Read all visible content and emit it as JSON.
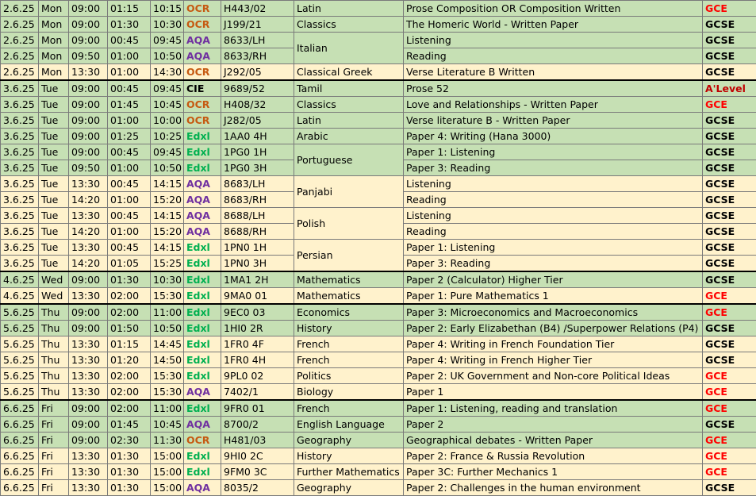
{
  "colors": {
    "green_row": "#c6e0b4",
    "yellow_row": "#fff2cc",
    "OCR": "#c65911",
    "AQA": "#7030a0",
    "Edxl": "#00b050",
    "GCE": "#ff0000",
    "A'Level": "#c00000"
  },
  "rows": [
    {
      "date": "2.6.25",
      "day": "Mon",
      "start": "09:00",
      "dur": "01:15",
      "end": "10:15",
      "board": "OCR",
      "code": "H443/02",
      "subject": "Latin",
      "paper": "Prose Composition OR Composition Written",
      "qual": "GCE",
      "bg": "g",
      "sep": false,
      "span": 1
    },
    {
      "date": "2.6.25",
      "day": "Mon",
      "start": "09:00",
      "dur": "01:30",
      "end": "10:30",
      "board": "OCR",
      "code": "J199/21",
      "subject": "Classics",
      "paper": "The Homeric World - Written Paper",
      "qual": "GCSE",
      "bg": "g",
      "sep": false,
      "span": 1
    },
    {
      "date": "2.6.25",
      "day": "Mon",
      "start": "09:00",
      "dur": "00:45",
      "end": "09:45",
      "board": "AQA",
      "code": "8633/LH",
      "subject": "Italian",
      "paper": "Listening",
      "qual": "GCSE",
      "bg": "g",
      "sep": false,
      "span": 2
    },
    {
      "date": "2.6.25",
      "day": "Mon",
      "start": "09:50",
      "dur": "01:00",
      "end": "10:50",
      "board": "AQA",
      "code": "8633/RH",
      "subject": null,
      "paper": "Reading",
      "qual": "GCSE",
      "bg": "g",
      "sep": false,
      "span": 0
    },
    {
      "date": "2.6.25",
      "day": "Mon",
      "start": "13:30",
      "dur": "01:00",
      "end": "14:30",
      "board": "OCR",
      "code": "J292/05",
      "subject": "Classical Greek",
      "paper": "Verse Literature B Written",
      "qual": "GCSE",
      "bg": "y",
      "sep": false,
      "span": 1
    },
    {
      "date": "3.6.25",
      "day": "Tue",
      "start": "09:00",
      "dur": "00:45",
      "end": "09:45",
      "board": "CIE",
      "code": "9689/52",
      "subject": "Tamil",
      "paper": "Prose 52",
      "qual": "A'Level",
      "bg": "g",
      "sep": true,
      "span": 1
    },
    {
      "date": "3.6.25",
      "day": "Tue",
      "start": "09:00",
      "dur": "01:45",
      "end": "10:45",
      "board": "OCR",
      "code": "H408/32",
      "subject": "Classics",
      "paper": "Love and Relationships - Written Paper",
      "qual": "GCE",
      "bg": "g",
      "sep": false,
      "span": 1
    },
    {
      "date": "3.6.25",
      "day": "Tue",
      "start": "09:00",
      "dur": "01:00",
      "end": "10:00",
      "board": "OCR",
      "code": "J282/05",
      "subject": "Latin",
      "paper": "Verse literature B - Written Paper",
      "qual": "GCSE",
      "bg": "g",
      "sep": false,
      "span": 1
    },
    {
      "date": "3.6.25",
      "day": "Tue",
      "start": "09:00",
      "dur": "01:25",
      "end": "10:25",
      "board": "Edxl",
      "code": "1AA0 4H",
      "subject": "Arabic",
      "paper": "Paper 4: Writing (Hana 3000)",
      "qual": "GCSE",
      "bg": "g",
      "sep": false,
      "span": 1
    },
    {
      "date": "3.6.25",
      "day": "Tue",
      "start": "09:00",
      "dur": "00:45",
      "end": "09:45",
      "board": "Edxl",
      "code": "1PG0 1H",
      "subject": "Portuguese",
      "paper": "Paper 1: Listening",
      "qual": "GCSE",
      "bg": "g",
      "sep": false,
      "span": 2
    },
    {
      "date": "3.6.25",
      "day": "Tue",
      "start": "09:50",
      "dur": "01:00",
      "end": "10:50",
      "board": "Edxl",
      "code": "1PG0 3H",
      "subject": null,
      "paper": "Paper 3: Reading",
      "qual": "GCSE",
      "bg": "g",
      "sep": false,
      "span": 0
    },
    {
      "date": "3.6.25",
      "day": "Tue",
      "start": "13:30",
      "dur": "00:45",
      "end": "14:15",
      "board": "AQA",
      "code": "8683/LH",
      "subject": "Panjabi",
      "paper": "Listening",
      "qual": "GCSE",
      "bg": "y",
      "sep": false,
      "span": 2
    },
    {
      "date": "3.6.25",
      "day": "Tue",
      "start": "14:20",
      "dur": "01:00",
      "end": "15:20",
      "board": "AQA",
      "code": "8683/RH",
      "subject": null,
      "paper": "Reading",
      "qual": "GCSE",
      "bg": "y",
      "sep": false,
      "span": 0
    },
    {
      "date": "3.6.25",
      "day": "Tue",
      "start": "13:30",
      "dur": "00:45",
      "end": "14:15",
      "board": "AQA",
      "code": "8688/LH",
      "subject": "Polish",
      "paper": "Listening",
      "qual": "GCSE",
      "bg": "y",
      "sep": false,
      "span": 2
    },
    {
      "date": "3.6.25",
      "day": "Tue",
      "start": "14:20",
      "dur": "01:00",
      "end": "15:20",
      "board": "AQA",
      "code": "8688/RH",
      "subject": null,
      "paper": "Reading",
      "qual": "GCSE",
      "bg": "y",
      "sep": false,
      "span": 0
    },
    {
      "date": "3.6.25",
      "day": "Tue",
      "start": "13:30",
      "dur": "00:45",
      "end": "14:15",
      "board": "Edxl",
      "code": "1PN0 1H",
      "subject": "Persian",
      "paper": "Paper 1: Listening",
      "qual": "GCSE",
      "bg": "y",
      "sep": false,
      "span": 2
    },
    {
      "date": "3.6.25",
      "day": "Tue",
      "start": "14:20",
      "dur": "01:05",
      "end": "15:25",
      "board": "Edxl",
      "code": "1PN0 3H",
      "subject": null,
      "paper": "Paper 3: Reading",
      "qual": "GCSE",
      "bg": "y",
      "sep": false,
      "span": 0
    },
    {
      "date": "4.6.25",
      "day": "Wed",
      "start": "09:00",
      "dur": "01:30",
      "end": "10:30",
      "board": "Edxl",
      "code": "1MA1 2H",
      "subject": "Mathematics",
      "paper": "Paper 2 (Calculator) Higher Tier",
      "qual": "GCSE",
      "bg": "g",
      "sep": true,
      "span": 1
    },
    {
      "date": "4.6.25",
      "day": "Wed",
      "start": "13:30",
      "dur": "02:00",
      "end": "15:30",
      "board": "Edxl",
      "code": "9MA0 01",
      "subject": "Mathematics",
      "paper": "Paper 1: Pure Mathematics 1",
      "qual": "GCE",
      "bg": "y",
      "sep": false,
      "span": 1
    },
    {
      "date": "5.6.25",
      "day": "Thu",
      "start": "09:00",
      "dur": "02:00",
      "end": "11:00",
      "board": "Edxl",
      "code": "9EC0 03",
      "subject": "Economics",
      "paper": "Paper 3: Microeconomics and Macroeconomics",
      "qual": "GCE",
      "bg": "g",
      "sep": true,
      "span": 1
    },
    {
      "date": "5.6.25",
      "day": "Thu",
      "start": "09:00",
      "dur": "01:50",
      "end": "10:50",
      "board": "Edxl",
      "code": "1HI0 2R",
      "subject": "History",
      "paper": "Paper 2: Early Elizabethan (B4) /Superpower Relations (P4)",
      "qual": "GCSE",
      "bg": "g",
      "sep": false,
      "span": 1
    },
    {
      "date": "5.6.25",
      "day": "Thu",
      "start": "13:30",
      "dur": "01:15",
      "end": "14:45",
      "board": "Edxl",
      "code": "1FR0 4F",
      "subject": "French",
      "paper": "Paper 4: Writing in French Foundation Tier",
      "qual": "GCSE",
      "bg": "y",
      "sep": false,
      "span": 1
    },
    {
      "date": "5.6.25",
      "day": "Thu",
      "start": "13:30",
      "dur": "01:20",
      "end": "14:50",
      "board": "Edxl",
      "code": "1FR0 4H",
      "subject": "French",
      "paper": "Paper 4: Writing in French Higher Tier",
      "qual": "GCSE",
      "bg": "y",
      "sep": false,
      "span": 1
    },
    {
      "date": "5.6.25",
      "day": "Thu",
      "start": "13:30",
      "dur": "02:00",
      "end": "15:30",
      "board": "Edxl",
      "code": "9PL0 02",
      "subject": "Politics",
      "paper": "Paper 2: UK Government and Non-core Political Ideas",
      "qual": "GCE",
      "bg": "y",
      "sep": false,
      "span": 1
    },
    {
      "date": "5.6.25",
      "day": "Thu",
      "start": "13:30",
      "dur": "02:00",
      "end": "15:30",
      "board": "AQA",
      "code": "7402/1",
      "subject": "Biology",
      "paper": "Paper 1",
      "qual": "GCE",
      "bg": "y",
      "sep": false,
      "span": 1
    },
    {
      "date": "6.6.25",
      "day": "Fri",
      "start": "09:00",
      "dur": "02:00",
      "end": "11:00",
      "board": "Edxl",
      "code": "9FR0 01",
      "subject": "French",
      "paper": "Paper 1: Listening, reading and translation",
      "qual": "GCE",
      "bg": "g",
      "sep": true,
      "span": 1
    },
    {
      "date": "6.6.25",
      "day": "Fri",
      "start": "09:00",
      "dur": "01:45",
      "end": "10:45",
      "board": "AQA",
      "code": "8700/2",
      "subject": "English Language",
      "paper": "Paper 2",
      "qual": "GCSE",
      "bg": "g",
      "sep": false,
      "span": 1
    },
    {
      "date": "6.6.25",
      "day": "Fri",
      "start": "09:00",
      "dur": "02:30",
      "end": "11:30",
      "board": "OCR",
      "code": "H481/03",
      "subject": "Geography",
      "paper": "Geographical debates - Written Paper",
      "qual": "GCE",
      "bg": "g",
      "sep": false,
      "span": 1
    },
    {
      "date": "6.6.25",
      "day": "Fri",
      "start": "13:30",
      "dur": "01:30",
      "end": "15:00",
      "board": "Edxl",
      "code": "9HI0 2C",
      "subject": "History",
      "paper": "Paper 2: France & Russia Revolution",
      "qual": "GCE",
      "bg": "y",
      "sep": false,
      "span": 1
    },
    {
      "date": "6.6.25",
      "day": "Fri",
      "start": "13:30",
      "dur": "01:30",
      "end": "15:00",
      "board": "Edxl",
      "code": "9FM0 3C",
      "subject": "Further Mathematics",
      "paper": "Paper 3C: Further Mechanics 1",
      "qual": "GCE",
      "bg": "y",
      "sep": false,
      "span": 1
    },
    {
      "date": "6.6.25",
      "day": "Fri",
      "start": "13:30",
      "dur": "01:30",
      "end": "15:00",
      "board": "AQA",
      "code": "8035/2",
      "subject": "Geography",
      "paper": "Paper 2: Challenges in the human environment",
      "qual": "GCSE",
      "bg": "y",
      "sep": false,
      "span": 1
    }
  ]
}
